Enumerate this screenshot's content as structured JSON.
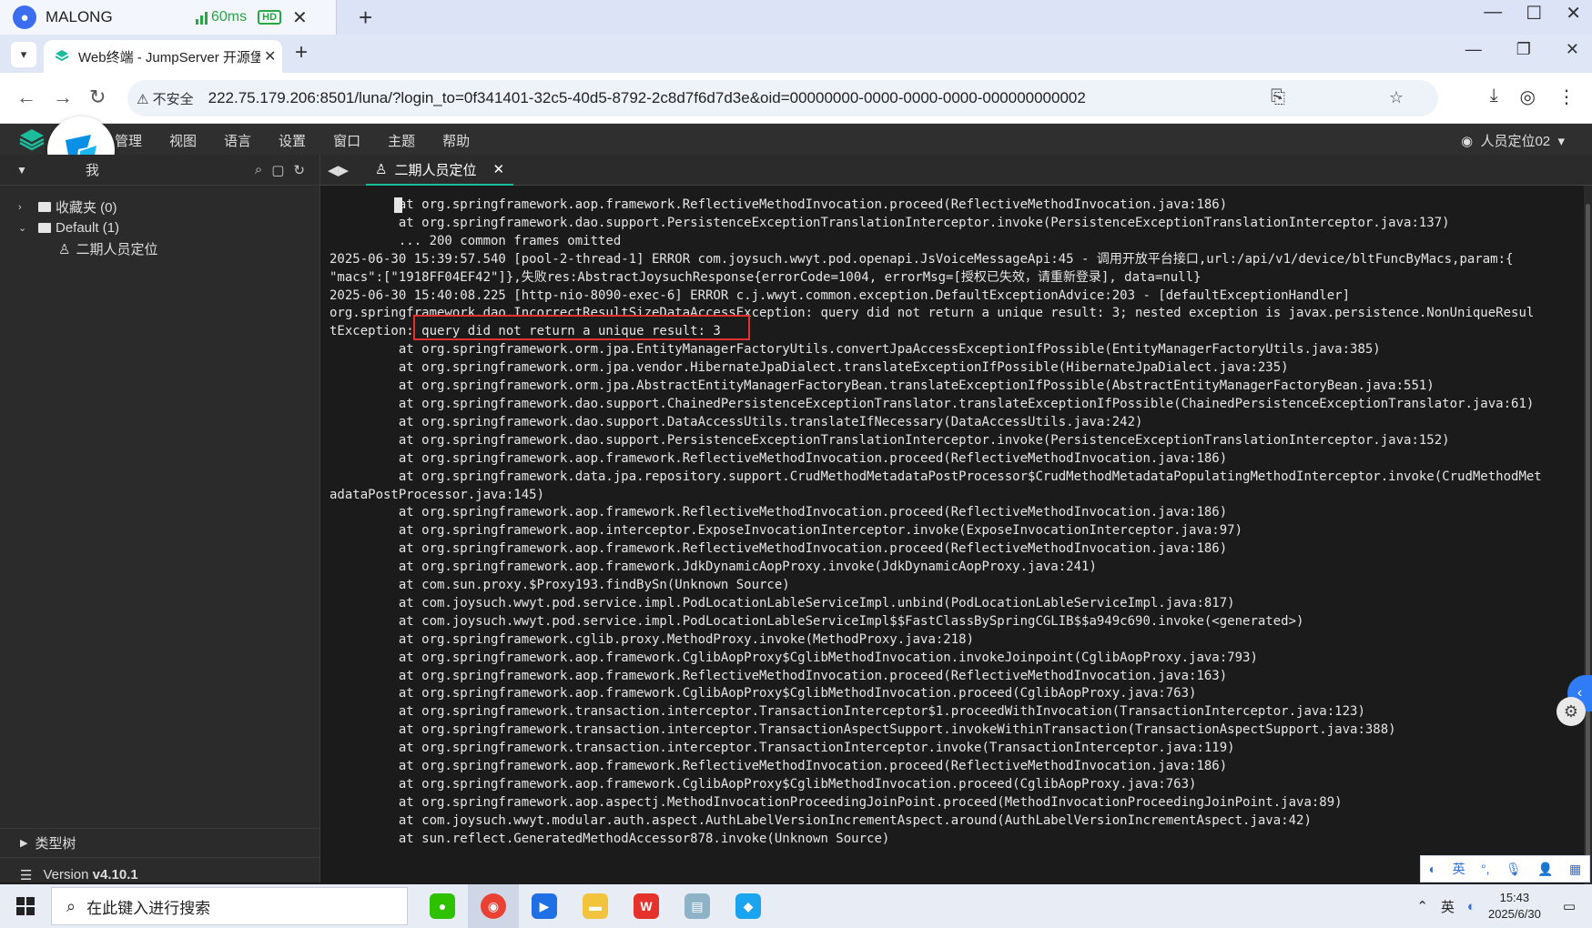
{
  "remote": {
    "user": "MALONG",
    "latency": "60ms",
    "hd": "HD"
  },
  "browser": {
    "tab_title": "Web终端 - JumpServer 开源堡",
    "security_label": "不安全",
    "url": "222.75.179.206:8501/luna/?login_to=0f341401-32c5-40d5-8792-2c8d7f6d7d3e&oid=00000000-0000-0000-0000-000000000002"
  },
  "menu": {
    "items": [
      "管理",
      "视图",
      "语言",
      "设置",
      "窗口",
      "主题",
      "帮助"
    ],
    "user": "人员定位02"
  },
  "sidebar": {
    "header": "我",
    "tree": [
      {
        "label": "收藏夹 (0)"
      },
      {
        "label": "Default (1)"
      },
      {
        "label": "二期人员定位"
      }
    ],
    "type_tree": "类型树",
    "version_label": "Version",
    "version": "v4.10.1"
  },
  "terminal": {
    "tab": "二期人员定位",
    "lines": [
      "         at org.springframework.aop.framework.ReflectiveMethodInvocation.proceed(ReflectiveMethodInvocation.java:186)",
      "         at org.springframework.dao.support.PersistenceExceptionTranslationInterceptor.invoke(PersistenceExceptionTranslationInterceptor.java:137)",
      "         ... 200 common frames omitted",
      "2025-06-30 15:39:57.540 [pool-2-thread-1] ERROR com.joysuch.wwyt.pod.openapi.JsVoiceMessageApi:45 - 调用开放平台接口,url:/api/v1/device/bltFuncByMacs,param:{",
      "\"macs\":[\"1918FF04EF42\"]},失败res:AbstractJoysuchResponse{errorCode=1004, errorMsg=[授权已失效，请重新登录], data=null}",
      "2025-06-30 15:40:08.225 [http-nio-8090-exec-6] ERROR c.j.wwyt.common.exception.DefaultExceptionAdvice:203 - [defaultExceptionHandler]",
      "org.springframework.dao.IncorrectResultSizeDataAccessException: query did not return a unique result: 3; nested exception is javax.persistence.NonUniqueResul",
      "tException: query did not return a unique result: 3",
      "         at org.springframework.orm.jpa.EntityManagerFactoryUtils.convertJpaAccessExceptionIfPossible(EntityManagerFactoryUtils.java:385)",
      "         at org.springframework.orm.jpa.vendor.HibernateJpaDialect.translateExceptionIfPossible(HibernateJpaDialect.java:235)",
      "         at org.springframework.orm.jpa.AbstractEntityManagerFactoryBean.translateExceptionIfPossible(AbstractEntityManagerFactoryBean.java:551)",
      "         at org.springframework.dao.support.ChainedPersistenceExceptionTranslator.translateExceptionIfPossible(ChainedPersistenceExceptionTranslator.java:61)",
      "         at org.springframework.dao.support.DataAccessUtils.translateIfNecessary(DataAccessUtils.java:242)",
      "         at org.springframework.dao.support.PersistenceExceptionTranslationInterceptor.invoke(PersistenceExceptionTranslationInterceptor.java:152)",
      "         at org.springframework.aop.framework.ReflectiveMethodInvocation.proceed(ReflectiveMethodInvocation.java:186)",
      "         at org.springframework.data.jpa.repository.support.CrudMethodMetadataPostProcessor$CrudMethodMetadataPopulatingMethodInterceptor.invoke(CrudMethodMet",
      "adataPostProcessor.java:145)",
      "         at org.springframework.aop.framework.ReflectiveMethodInvocation.proceed(ReflectiveMethodInvocation.java:186)",
      "         at org.springframework.aop.interceptor.ExposeInvocationInterceptor.invoke(ExposeInvocationInterceptor.java:97)",
      "         at org.springframework.aop.framework.ReflectiveMethodInvocation.proceed(ReflectiveMethodInvocation.java:186)",
      "         at org.springframework.aop.framework.JdkDynamicAopProxy.invoke(JdkDynamicAopProxy.java:241)",
      "         at com.sun.proxy.$Proxy193.findBySn(Unknown Source)",
      "         at com.joysuch.wwyt.pod.service.impl.PodLocationLableServiceImpl.unbind(PodLocationLableServiceImpl.java:817)",
      "         at com.joysuch.wwyt.pod.service.impl.PodLocationLableServiceImpl$$FastClassBySpringCGLIB$$a949c690.invoke(<generated>)",
      "         at org.springframework.cglib.proxy.MethodProxy.invoke(MethodProxy.java:218)",
      "         at org.springframework.aop.framework.CglibAopProxy$CglibMethodInvocation.invokeJoinpoint(CglibAopProxy.java:793)",
      "         at org.springframework.aop.framework.ReflectiveMethodInvocation.proceed(ReflectiveMethodInvocation.java:163)",
      "         at org.springframework.aop.framework.CglibAopProxy$CglibMethodInvocation.proceed(CglibAopProxy.java:763)",
      "         at org.springframework.transaction.interceptor.TransactionInterceptor$1.proceedWithInvocation(TransactionInterceptor.java:123)",
      "         at org.springframework.transaction.interceptor.TransactionAspectSupport.invokeWithinTransaction(TransactionAspectSupport.java:388)",
      "         at org.springframework.transaction.interceptor.TransactionInterceptor.invoke(TransactionInterceptor.java:119)",
      "         at org.springframework.aop.framework.ReflectiveMethodInvocation.proceed(ReflectiveMethodInvocation.java:186)",
      "         at org.springframework.aop.framework.CglibAopProxy$CglibMethodInvocation.proceed(CglibAopProxy.java:763)",
      "         at org.springframework.aop.aspectj.MethodInvocationProceedingJoinPoint.proceed(MethodInvocationProceedingJoinPoint.java:89)",
      "         at com.joysuch.wwyt.modular.auth.aspect.AuthLabelVersionIncrementAspect.around(AuthLabelVersionIncrementAspect.java:42)",
      "         at sun.reflect.GeneratedMethodAccessor878.invoke(Unknown Source)"
    ]
  },
  "ime": {
    "lang": "英"
  },
  "taskbar": {
    "search_placeholder": "在此键入进行搜索",
    "tray_lang": "英",
    "time": "15:43",
    "date": "2025/6/30"
  },
  "colors": {
    "highlight_box": "#e53030",
    "accent": "#1abc9c"
  }
}
